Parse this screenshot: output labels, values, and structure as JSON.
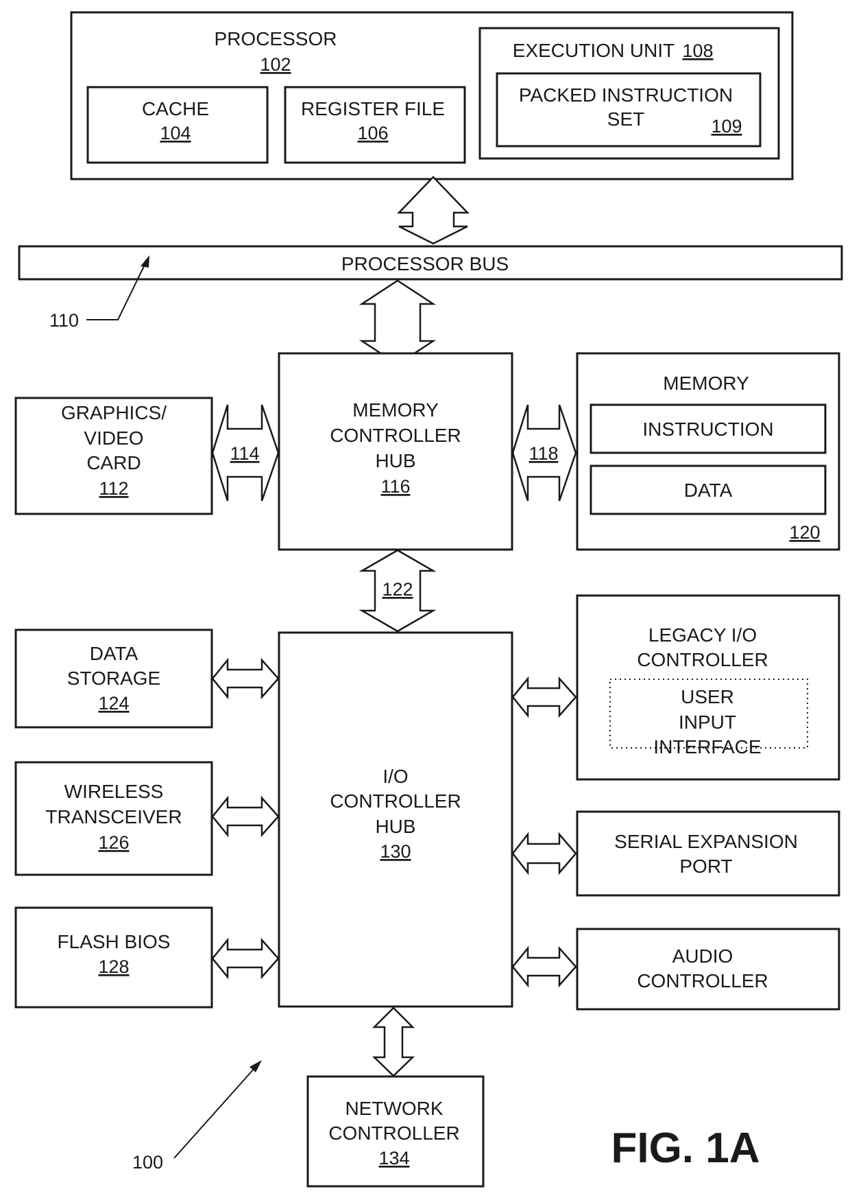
{
  "figure": {
    "title": "FIG. 1A",
    "system_ref": "100",
    "bus_ref": "110"
  },
  "processor": {
    "label": "PROCESSOR",
    "ref": "102",
    "cache": {
      "label": "CACHE",
      "ref": "104"
    },
    "register_file": {
      "label": "REGISTER FILE",
      "ref": "106"
    },
    "execution_unit": {
      "label": "EXECUTION UNIT",
      "ref": "108",
      "packed_instruction_set": {
        "line1": "PACKED INSTRUCTION",
        "line2": "SET",
        "ref": "109"
      }
    }
  },
  "processor_bus": {
    "label": "PROCESSOR BUS"
  },
  "graphics_card": {
    "line1": "GRAPHICS/",
    "line2": "VIDEO",
    "line3": "CARD",
    "ref": "112"
  },
  "link_114": {
    "ref": "114"
  },
  "memory_controller_hub": {
    "line1": "MEMORY",
    "line2": "CONTROLLER",
    "line3": "HUB",
    "ref": "116"
  },
  "link_118": {
    "ref": "118"
  },
  "memory": {
    "label": "MEMORY",
    "instruction": "INSTRUCTION",
    "data": "DATA",
    "ref": "120"
  },
  "link_122": {
    "ref": "122"
  },
  "data_storage": {
    "line1": "DATA",
    "line2": "STORAGE",
    "ref": "124"
  },
  "wireless_transceiver": {
    "line1": "WIRELESS",
    "line2": "TRANSCEIVER",
    "ref": "126"
  },
  "flash_bios": {
    "line1": "FLASH BIOS",
    "ref": "128"
  },
  "io_controller_hub": {
    "line1": "I/O",
    "line2": "CONTROLLER",
    "line3": "HUB",
    "ref": "130"
  },
  "legacy_io": {
    "line1": "LEGACY I/O",
    "line2": "CONTROLLER",
    "user_input": {
      "line1": "USER",
      "line2": "INPUT",
      "line3": "INTERFACE"
    }
  },
  "serial_expansion": {
    "line1": "SERIAL EXPANSION",
    "line2": "PORT"
  },
  "audio_controller": {
    "line1": "AUDIO",
    "line2": "CONTROLLER"
  },
  "network_controller": {
    "line1": "NETWORK",
    "line2": "CONTROLLER",
    "ref": "134"
  }
}
